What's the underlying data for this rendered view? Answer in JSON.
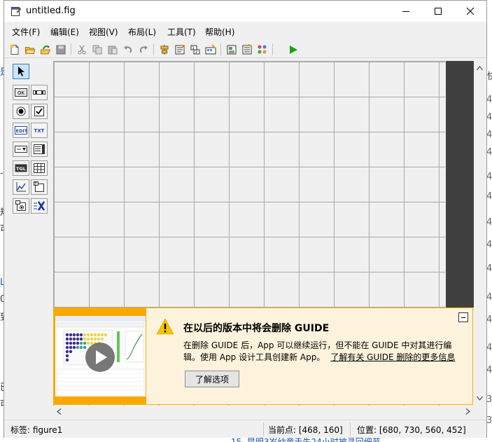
{
  "window": {
    "title": "untitled.fig"
  },
  "menubar": {
    "items": [
      {
        "label": "文件(F)"
      },
      {
        "label": "编辑(E)"
      },
      {
        "label": "视图(V)"
      },
      {
        "label": "布局(L)"
      },
      {
        "label": "工具(T)"
      },
      {
        "label": "帮助(H)"
      }
    ]
  },
  "toolbar": {
    "icons": [
      "new-figure-icon",
      "open-icon",
      "import-icon",
      "save-icon",
      "cut-icon",
      "copy-icon",
      "paste-icon",
      "undo-icon",
      "redo-icon",
      "align-objects-icon",
      "menu-editor-icon",
      "tab-order-icon",
      "toolbar-editor-icon",
      "editor-icon",
      "property-inspector-icon",
      "object-browser-icon",
      "run-figure-icon"
    ]
  },
  "palette": {
    "items": [
      {
        "icon": "select-arrow-icon",
        "text": ""
      },
      {
        "icon": "push-button-icon",
        "text": "OK"
      },
      {
        "icon": "slider-icon",
        "text": ""
      },
      {
        "icon": "radio-button-icon",
        "text": ""
      },
      {
        "icon": "check-box-icon",
        "text": ""
      },
      {
        "icon": "edit-text-icon",
        "text": "EDIT"
      },
      {
        "icon": "static-text-icon",
        "text": "TXT"
      },
      {
        "icon": "popup-menu-icon",
        "text": ""
      },
      {
        "icon": "list-box-icon",
        "text": ""
      },
      {
        "icon": "toggle-button-icon",
        "text": "TGL"
      },
      {
        "icon": "table-icon",
        "text": ""
      },
      {
        "icon": "axes-icon",
        "text": ""
      },
      {
        "icon": "panel-icon",
        "text": ""
      },
      {
        "icon": "button-group-icon",
        "text": ""
      },
      {
        "icon": "activex-control-icon",
        "text": ""
      }
    ]
  },
  "banner": {
    "headline": "在以后的版本中将会删除 GUIDE",
    "body_line": "在删除 GUIDE 后，App 可以继续运行，但不能在 GUIDE 中对其进行编辑。使用 App 设计工具创建新 App。",
    "link_text": "了解有关 GUIDE 删除的更多信息",
    "button_label": "了解选项"
  },
  "statusbar": {
    "tag": "标签: figure1",
    "current_point": "当前点:  [468, 160]",
    "position": "位置: [680, 730, 560, 452]"
  },
  "background_page": {
    "fragments": [
      "是",
      "-C",
      "规",
      "可",
      "L",
      "0",
      "到",
      "已",
      "可",
      "快",
      "4",
      "4",
      "4",
      "4",
      "4",
      "4",
      "4",
      "4",
      "4",
      "4",
      "4",
      "4",
      "4",
      "3",
      "3",
      "15. 昆明3岁幼童走失24小时被寻回细节"
    ]
  },
  "colors": {
    "banner_bg": "#fdf3dc",
    "banner_border": "#f4b400",
    "canvas_grid": "#a9a9a9",
    "dark_strip": "#404040",
    "run_green": "#1aa31a"
  }
}
